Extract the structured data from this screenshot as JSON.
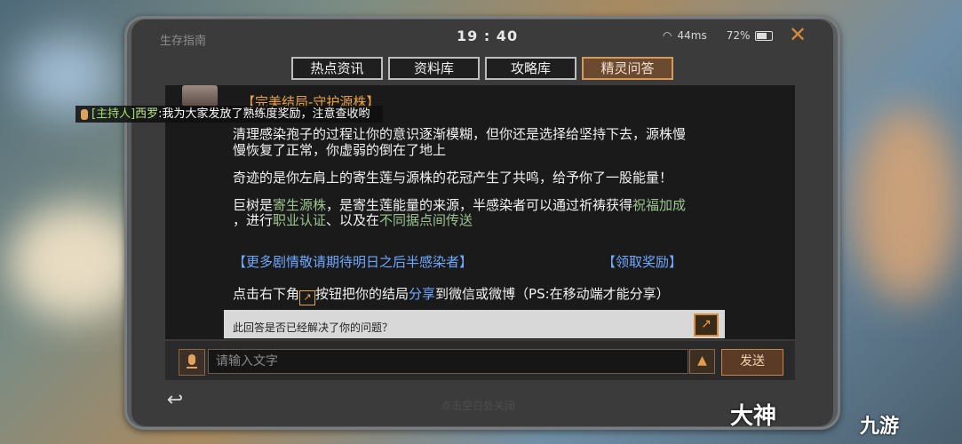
{
  "topbar": {
    "title": "生存指南",
    "time": "19 : 40",
    "network": "44ms",
    "battery": "72%"
  },
  "tabs": [
    {
      "label": "热点资讯"
    },
    {
      "label": "资料库"
    },
    {
      "label": "攻略库"
    },
    {
      "label": "精灵问答",
      "active": true
    }
  ],
  "host_message": {
    "tag": "[主持人]",
    "name": "西罗",
    "text": ":我为大家发放了熟练度奖励，注意查收哟"
  },
  "answer": {
    "header": "【完美结局-守护源株】",
    "p1_line1": "清理感染孢子的过程让你的意识逐渐模糊，但你还是选择给坚持下去，源株慢",
    "p1_line2": "慢恢复了正常，你虚弱的倒在了地上",
    "p2": "奇迹的是你左肩上的寄生莲与源株的花冠产生了共鸣，给予你了一股能量！",
    "p3_a": "巨树是",
    "p3_link1": "寄生源株",
    "p3_b": "，是寄生莲能量的来源，半感染者可以通过祈祷获得",
    "p3_link2": "祝福加成",
    "p4_a": "，进行",
    "p4_link1": "职业认证",
    "p4_b": "、以及在",
    "p4_link2": "不同据点间传送",
    "more_link": "【更多剧情敬请期待明日之后半感染者】",
    "reward_link": "【领取奖励】",
    "share_a": "点击右下角",
    "share_b": "按钮把你的结局",
    "share_word": "分享",
    "share_c": "到微信或微博（PS:在移动端才能分享）"
  },
  "feedback": {
    "question": "此回答是否已经解决了你的问题？"
  },
  "input": {
    "placeholder": "请输入文字",
    "send_label": "发送"
  },
  "footer": {
    "hint": "点击空白处关闭"
  },
  "watermarks": {
    "left": "大神",
    "right": "九游"
  },
  "colors": {
    "accent": "#d69a5a",
    "link": "#6fa8ff",
    "highlight_green": "#9bc48f"
  }
}
